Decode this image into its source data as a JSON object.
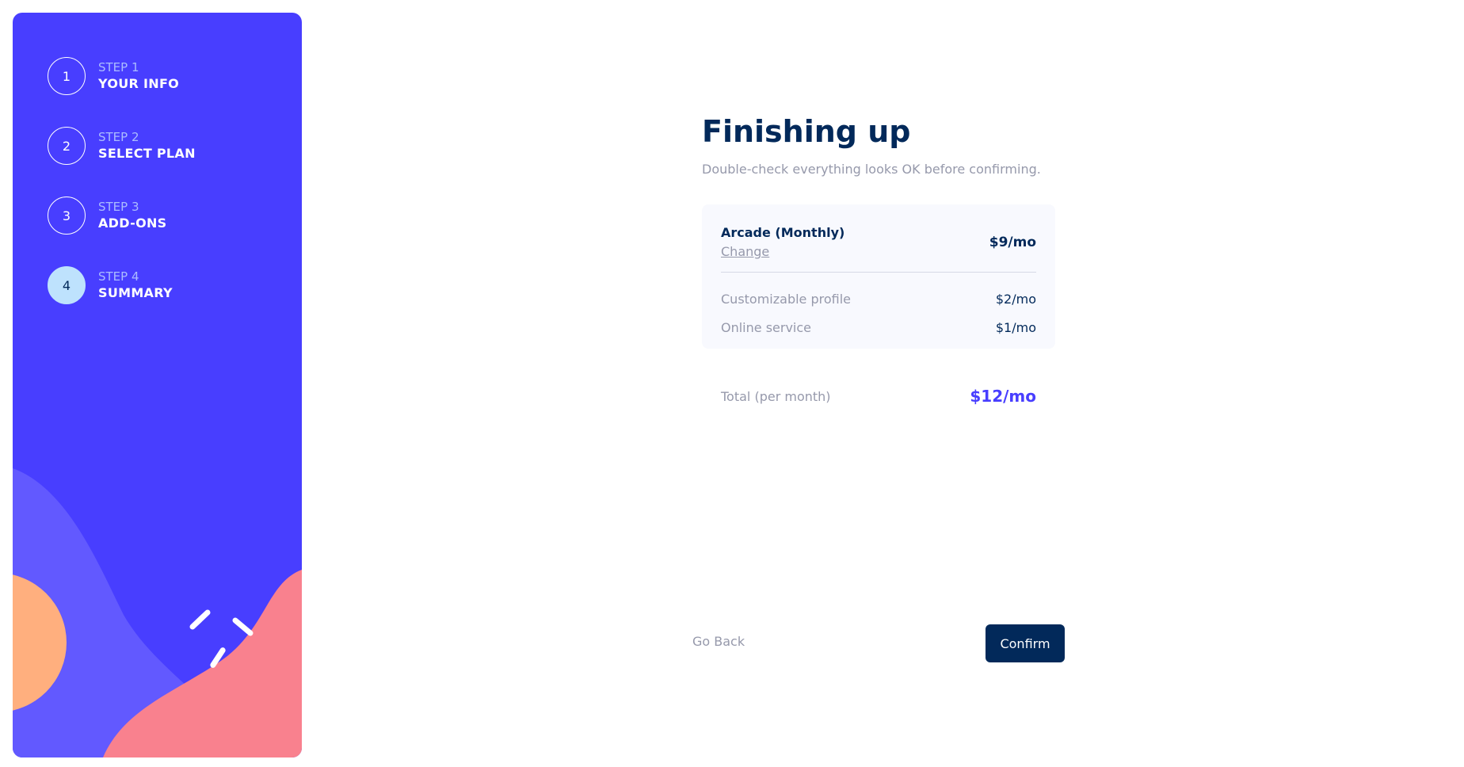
{
  "colors": {
    "sidebar_bg": "#483eff",
    "active_step": "#bee2fd",
    "primary_text": "#02295a",
    "muted_text": "#9699ab",
    "accent": "#483eff",
    "confirm_bg": "#02295a"
  },
  "sidebar": {
    "steps": [
      {
        "number": "1",
        "label": "STEP 1",
        "title": "YOUR INFO",
        "active": false
      },
      {
        "number": "2",
        "label": "STEP 2",
        "title": "SELECT PLAN",
        "active": false
      },
      {
        "number": "3",
        "label": "STEP 3",
        "title": "ADD-ONS",
        "active": false
      },
      {
        "number": "4",
        "label": "STEP 4",
        "title": "SUMMARY",
        "active": true
      }
    ]
  },
  "main": {
    "title": "Finishing up",
    "subtitle": "Double-check everything looks OK before confirming."
  },
  "summary": {
    "plan_name": "Arcade (Monthly)",
    "change_label": "Change",
    "plan_price": "$9/mo",
    "addons": [
      {
        "name": "Customizable profile",
        "price": "$2/mo"
      },
      {
        "name": "Online service",
        "price": "$1/mo"
      }
    ],
    "total_label": "Total (per month)",
    "total_price": "$12/mo"
  },
  "actions": {
    "back_label": "Go Back",
    "confirm_label": "Confirm"
  }
}
